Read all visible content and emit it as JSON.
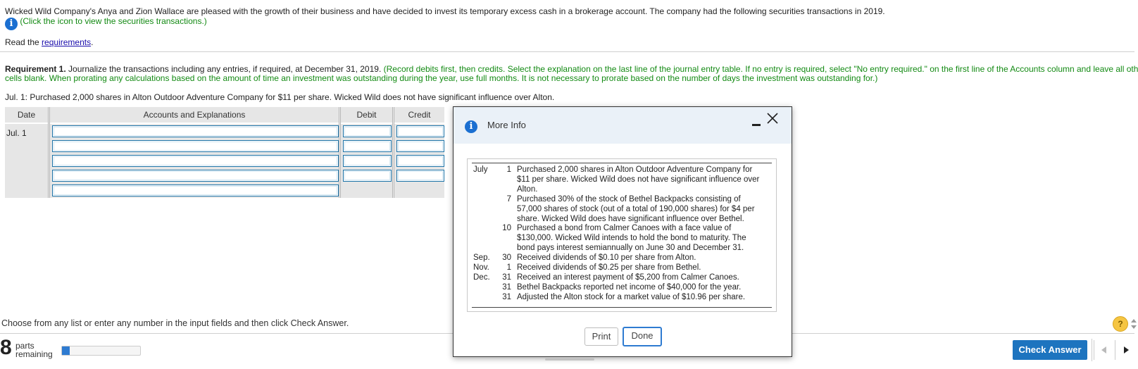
{
  "problem": {
    "intro": "Wicked Wild Company's Anya and Zion Wallace are pleased with the growth of their business and have decided to invest its temporary excess cash in a brokerage account. The company had the following securities transactions in 2019.",
    "icon_hint": "(Click the icon to view the securities transactions.)",
    "read_prefix": "Read the ",
    "read_link": "requirements",
    "read_suffix": "."
  },
  "requirement": {
    "label": "Requirement 1.",
    "text": " Journalize the transactions including any entries, if required, at December 31, 2019. ",
    "instruction_line1": "(Record debits first, then credits. Select the explanation on the last line of the journal entry table. If no entry is required, select \"No entry required.\" on the first line of the Accounts column and leave all other",
    "instruction_line2": "cells blank. When prorating any calculations based on the amount of time an investment was outstanding during the year, use full months. It is not necessary to prorate based on the number of days the investment was outstanding for.)"
  },
  "transaction_prompt": "Jul. 1: Purchased 2,000 shares in Alton Outdoor Adventure Company for $11 per share. Wicked Wild does not have significant influence over Alton.",
  "journal": {
    "headers": {
      "date": "Date",
      "accounts": "Accounts and Explanations",
      "debit": "Debit",
      "credit": "Credit"
    },
    "date_value": "Jul. 1"
  },
  "modal": {
    "title": "More Info",
    "transactions": [
      {
        "month": "July",
        "day": "1",
        "lines": [
          "Purchased 2,000 shares in Alton Outdoor Adventure Company for",
          "$11 per share. Wicked Wild does not have significant influence over",
          "Alton."
        ]
      },
      {
        "month": "",
        "day": "7",
        "lines": [
          "Purchased 30% of the stock of Bethel Backpacks consisting of",
          "57,000 shares of stock (out of a total of 190,000 shares) for $4 per",
          "share. Wicked Wild does have significant influence over Bethel."
        ]
      },
      {
        "month": "",
        "day": "10",
        "lines": [
          "Purchased a bond from Calmer Canoes with a face value of",
          "$130,000. Wicked Wild intends to hold the bond to maturity. The",
          "bond pays interest semiannually on June 30 and December 31."
        ]
      },
      {
        "month": "Sep.",
        "day": "30",
        "lines": [
          "Received dividends of $0.10 per share from Alton."
        ]
      },
      {
        "month": "Nov.",
        "day": "1",
        "lines": [
          "Received dividends of $0.25 per share from Bethel."
        ]
      },
      {
        "month": "Dec.",
        "day": "31",
        "lines": [
          "Received an interest payment of $5,200 from Calmer Canoes."
        ]
      },
      {
        "month": "",
        "day": "31",
        "lines": [
          "Bethel Backpacks reported net income of $40,000 for the year."
        ]
      },
      {
        "month": "",
        "day": "31",
        "lines": [
          "Adjusted the Alton stock for a market value of $10.96 per share."
        ]
      }
    ],
    "print_label": "Print",
    "done_label": "Done"
  },
  "footer": {
    "hint": "Choose from any list or enter any number in the input fields and then click Check Answer.",
    "parts_count": "8",
    "parts_label_1": "parts",
    "parts_label_2": "remaining",
    "progress_fraction": 0.1,
    "check_answer": "Check Answer",
    "help_glyph": "?"
  },
  "colors": {
    "instruction_green": "#138a13",
    "accent_blue": "#1d74bf",
    "link_blue": "#1a0dab"
  },
  "icons": [
    "info-icon",
    "minimize-icon",
    "close-icon",
    "help-icon",
    "prev-arrow-icon",
    "next-arrow-icon"
  ]
}
